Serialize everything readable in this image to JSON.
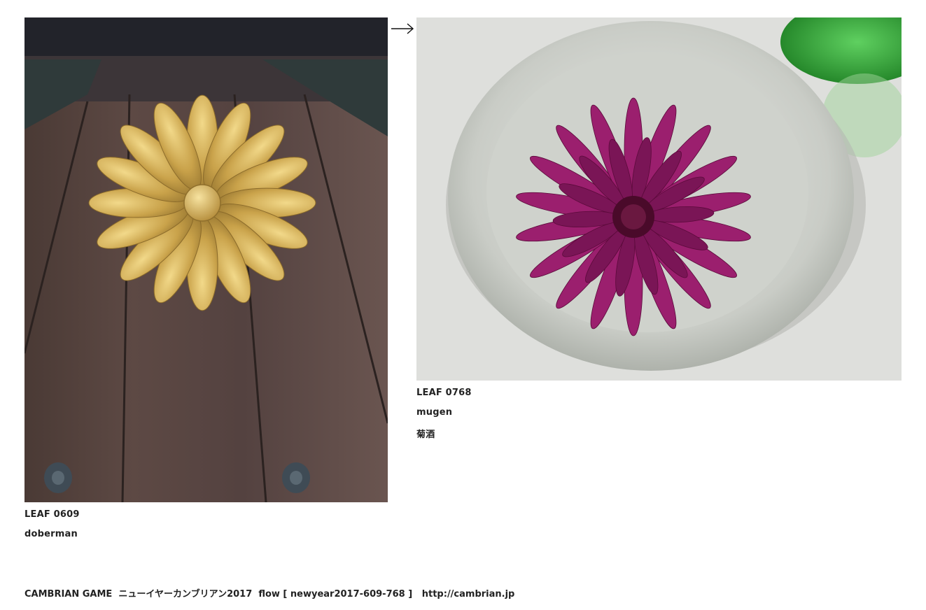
{
  "leaves": [
    {
      "number_label": "LEAF 0609",
      "author": "doberman",
      "title": ""
    },
    {
      "number_label": "LEAF 0768",
      "author": "mugen",
      "title": "菊酒"
    }
  ],
  "footer": {
    "game": "CAMBRIAN GAME",
    "event": "ニューイヤーカンブリアン2017",
    "flow": "flow [ newyear2017-609-768 ]",
    "url": "http://cambrian.jp"
  },
  "icons": {
    "arrow": "right-arrow-icon"
  },
  "colors": {
    "text": "#222222",
    "background": "#ffffff"
  }
}
